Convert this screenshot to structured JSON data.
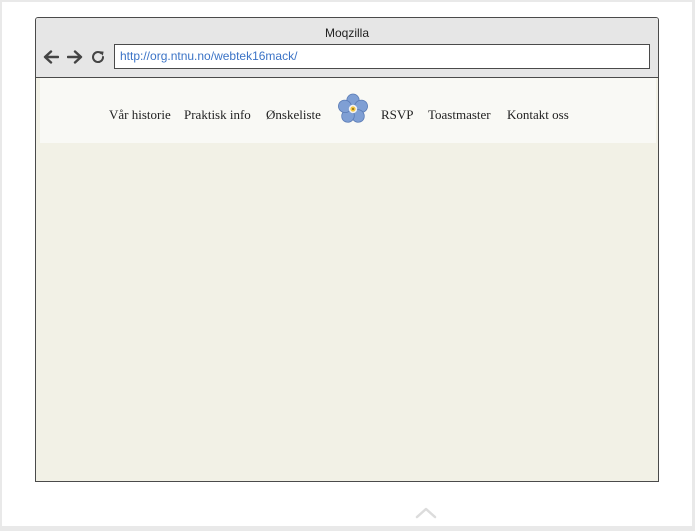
{
  "browser": {
    "title": "Moqzilla",
    "url": "http://org.ntnu.no/webtek16mack/",
    "nav_icons": {
      "back": "arrow-left-icon",
      "forward": "arrow-right-icon",
      "reload": "reload-icon"
    }
  },
  "site": {
    "nav_left": [
      "Vår historie",
      "Praktisk info",
      "Ønskeliste"
    ],
    "logo": "forget-me-not-flower-logo",
    "nav_right": [
      "RSVP",
      "Toastmaster",
      "Kontakt oss"
    ]
  },
  "page": {
    "scroll_top_icon": "chevron-up-icon"
  },
  "colors": {
    "page_background": "#f2f1e6",
    "header_background": "#f9f9f5",
    "chrome_background": "#e6e6e6",
    "url_text": "#3b73c6",
    "flower_petal": "#7f9fd4",
    "flower_center": "#f2c53d"
  }
}
